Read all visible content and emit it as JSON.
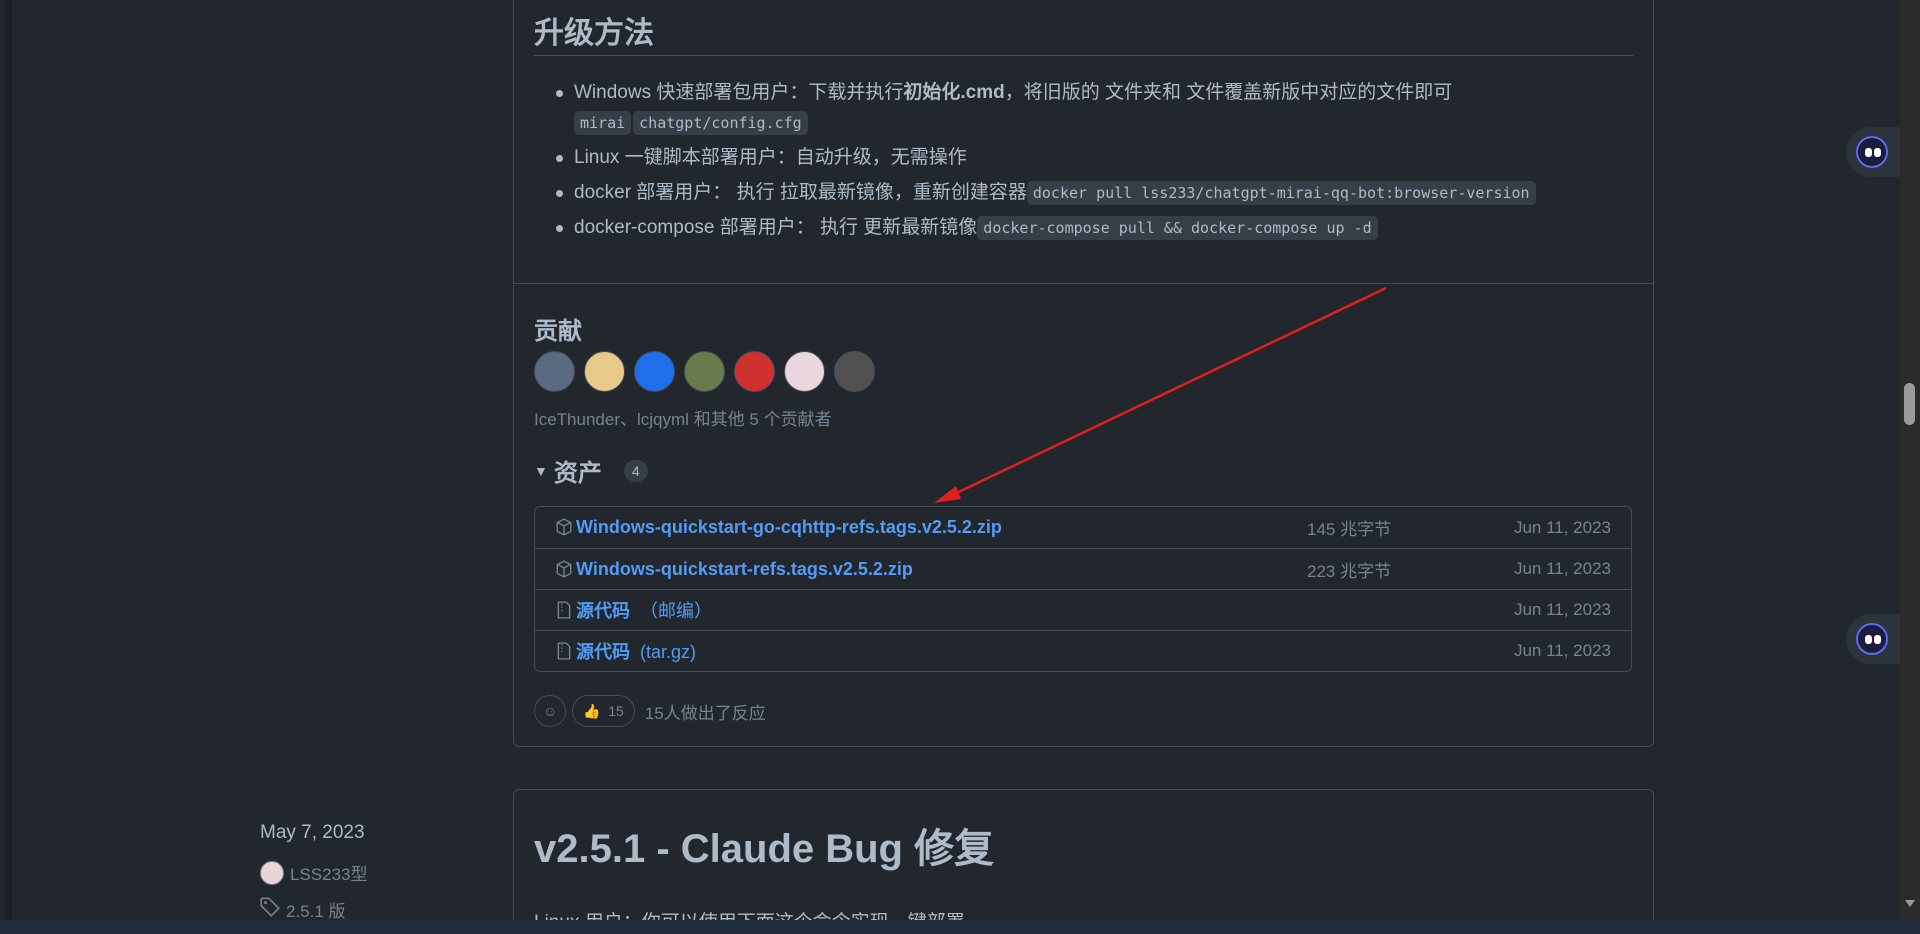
{
  "upgrade": {
    "title": "升级方法",
    "items": [
      {
        "text_before": "Windows 快速部署包用户：下载并执行",
        "bold": "初始化.cmd",
        "text_after": "，将旧版的 文件夹和 文件覆盖新版中对应的文件即可",
        "codes": [
          "mirai",
          "chatgpt/config.cfg"
        ]
      },
      {
        "text": "Linux 一键脚本部署用户：自动升级，无需操作"
      },
      {
        "text": "docker 部署用户： 执行 拉取最新镜像，重新创建容器",
        "code": "docker pull lss233/chatgpt-mirai-qq-bot:browser-version"
      },
      {
        "text": "docker-compose 部署用户： 执行 更新最新镜像",
        "code": "docker-compose pull && docker-compose up -d"
      }
    ]
  },
  "contributors": {
    "title": "贡献",
    "summary": "IceThunder、lcjqyml 和其他 5 个贡献者",
    "avatar_colors": [
      "#5a6a80",
      "#e8c98a",
      "#1f6feb",
      "#6b7a4a",
      "#d03030",
      "#e9d6de",
      "#505050"
    ]
  },
  "assets": {
    "title": "资产",
    "count": "4",
    "rows": [
      {
        "name": "Windows-quickstart-go-cqhttp-refs.tags.v2.5.2.zip",
        "suffix": "",
        "size": "145 兆字节",
        "date": "Jun 11, 2023",
        "icon": "package-icon"
      },
      {
        "name": "Windows-quickstart-refs.tags.v2.5.2.zip",
        "suffix": "",
        "size": "223 兆字节",
        "date": "Jun 11, 2023",
        "icon": "package-icon"
      },
      {
        "name": "源代码",
        "suffix": "（邮编）",
        "size": "",
        "date": "Jun 11, 2023",
        "icon": "file-zip-icon"
      },
      {
        "name": "源代码",
        "suffix": "(tar.gz)",
        "size": "",
        "date": "Jun 11, 2023",
        "icon": "file-zip-icon"
      }
    ]
  },
  "reactions": {
    "thumb_emoji": "👍",
    "thumb_count": "15",
    "summary": "15人做出了反应"
  },
  "next_release": {
    "date": "May 7, 2023",
    "author": "LSS233型",
    "tag": "2.5.1 版",
    "title": "v2.5.1 - Claude Bug 修复",
    "sub": "Linux 用户：你可以使用下面这个命令实现一键部署"
  },
  "accent_color": "#539bf5",
  "annotation_arrow_color": "#e02020"
}
